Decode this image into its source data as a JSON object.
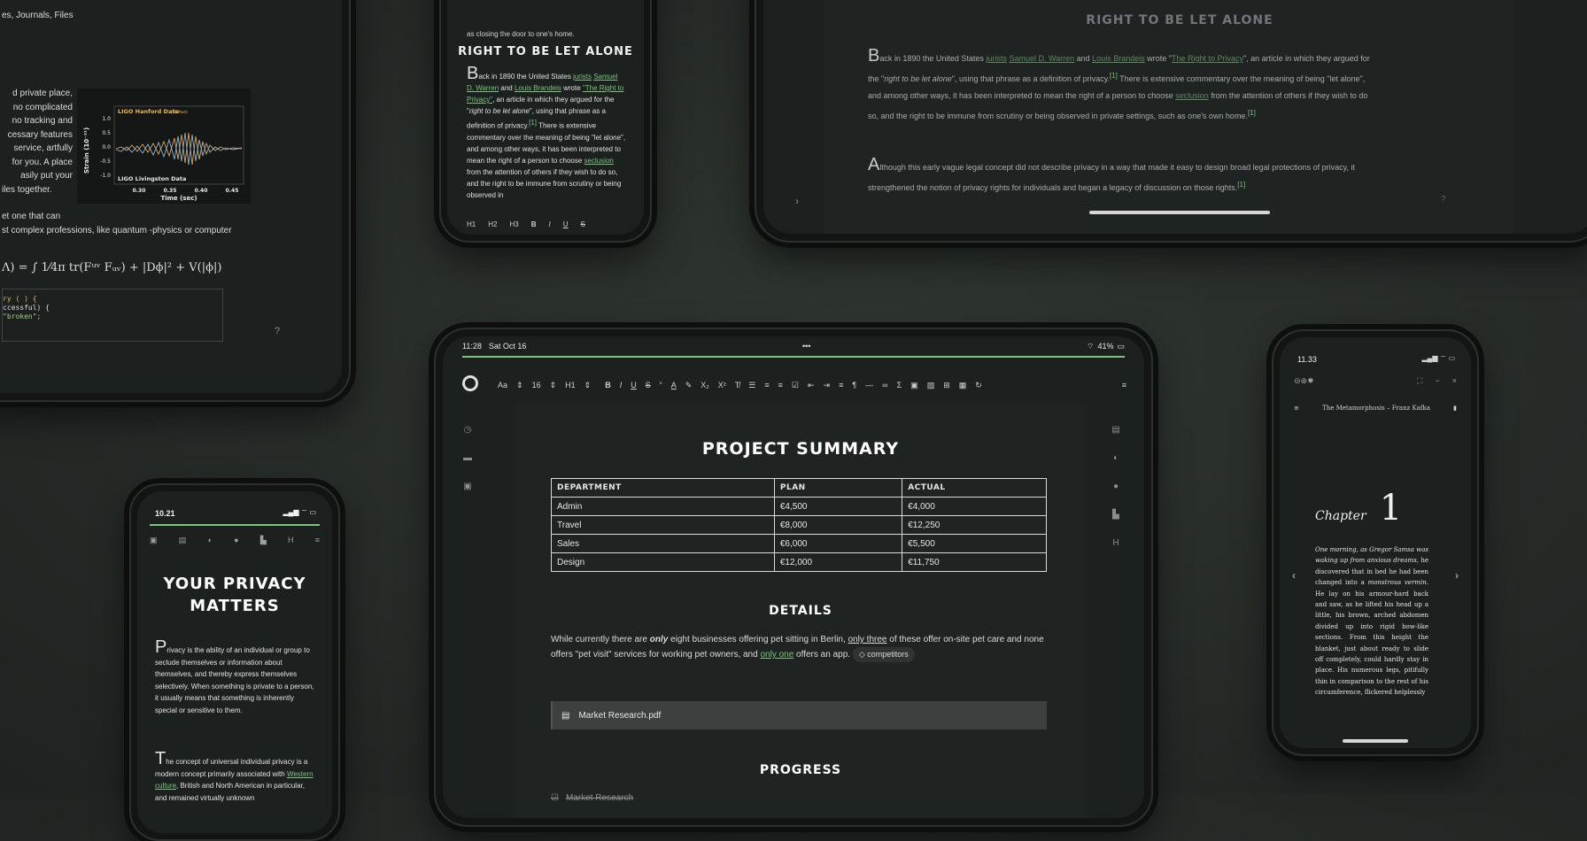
{
  "colors": {
    "accent": "#7cc47f",
    "background": "#262b28",
    "screen": "#1c201f"
  },
  "top_left_tablet": {
    "partial_heading": "es, Journals, Files",
    "para_lines": [
      "d private place,",
      "no complicated",
      "no tracking and",
      "cessary features",
      "service, artfully",
      "for you. A place",
      "asily put your",
      "iles together."
    ],
    "para_bold": "private",
    "line2": "et one that can",
    "line3": "st complex professions, like quantum -physics or computer",
    "formula": "Λ) = ∫ 1⁄4π tr(Fᵘᵛ Fᵤᵥ) + |Dϕ|² + V(|ϕ|)",
    "code": [
      "ry ( ) {",
      "ccessful) {",
      "\"broken\";"
    ],
    "chart": {
      "title_top": "LIGO Hanford Data",
      "title_top_note": "(shifted)",
      "title_bottom": "LIGO Livingston Data",
      "ylabel": "Strain (10⁻²¹)",
      "xlabel": "Time (sec)",
      "yticks": [
        "1.0",
        "0.5",
        "0.0",
        "-0.5",
        "-1.0"
      ],
      "xticks": [
        "0.30",
        "0.35",
        "0.40",
        "0.45"
      ]
    },
    "help": "?"
  },
  "top_phone": {
    "partial_line": "as closing the door to one's home.",
    "title": "RIGHT TO BE LET ALONE",
    "p_cap": "B",
    "p1a": "ack in 1890 the United States ",
    "link_jurists": "jurists",
    "link_warren": "Samuel D. Warren",
    "and": " and ",
    "link_brandeis": "Louis Brandeis",
    "wrote": " wrote",
    "link_right": "\"The Right to Privacy\"",
    "p1b": ", an article in which they argued for the \"",
    "italic": "right to be let alone",
    "p1c": "\", using that phrase as a definition of privacy.",
    "ref1": "[1]",
    "p1d": " There is extensive commentary over the meaning of being \"let alone\", and among other ways, it has been interpreted to mean the right of a person to choose ",
    "link_seclusion": "seclusion",
    "p1e": " from the attention of others if they wish to do so, and the right to be immune from scrutiny or being observed in",
    "toolbar": [
      "H1",
      "H2",
      "H3",
      "B",
      "I",
      "U",
      "S"
    ]
  },
  "top_right_tablet": {
    "title": "RIGHT TO BE LET ALONE",
    "p1_cap": "B",
    "p1a": "ack in 1890 the United States ",
    "link_jurists": "jurists",
    "link_warren": "Samuel D. Warren",
    "and": " and ",
    "link_brandeis": "Louis Brandeis",
    "wrote": " wrote \"",
    "link_right": "The Right to Privacy",
    "p1b": "\", an article in which they argued for the \"",
    "italic": "right to be let alone",
    "p1c": "\", using that phrase as a definition of privacy.",
    "ref1": "[1]",
    "p1d": " There is extensive commentary over the meaning of being \"let alone\", and among other ways, it has been interpreted to mean the right of a person to choose ",
    "link_seclusion": "seclusion",
    "p1e": " from the attention of others if they wish to do so, and the right to be immune from scrutiny or being observed in private settings, such as one's own home.",
    "ref2": "[1]",
    "p2_cap": "A",
    "p2": "lthough this early vague legal concept did not describe privacy in a way that made it easy to design broad legal protections of privacy, it strengthened the notion of privacy rights for individuals and began a legacy of discussion on those rights.",
    "ref3": "[1]",
    "nav_next": "›",
    "help": "?"
  },
  "bottom_left_phone": {
    "time": "10.21",
    "title_l1": "YOUR PRIVACY",
    "title_l2": "MATTERS",
    "p1_cap": "P",
    "p1": "rivacy is the ability of an individual or group to seclude themselves or information about themselves, and thereby express themselves selectively. When something is private to a person, it usually means that something is inherently special or sensitive to them.",
    "p2_cap": "T",
    "p2a": "he concept of universal individual privacy is a modern concept primarily associated with ",
    "link_western": "Western culture",
    "p2b": ", British and North American in particular, and remained virtually unknown"
  },
  "main_tablet": {
    "status": {
      "time": "11:28",
      "date": "Sat Oct 16",
      "dots": "•••",
      "battery": "41%"
    },
    "toolbar": {
      "font": "Aa",
      "size": "16",
      "heading": "H1",
      "items": [
        "B",
        "I",
        "U",
        "S",
        "“",
        "A",
        "✎",
        "X₂",
        "X²",
        "T̸",
        "☰",
        "≡",
        "≡",
        "☑",
        "⇤",
        "⇥",
        "≡",
        "¶",
        "—",
        "∞",
        "Σ",
        "▣",
        "▨",
        "⊞",
        "▦",
        "↻"
      ],
      "menu": "≡"
    },
    "doc_title": "PROJECT SUMMARY",
    "table": {
      "headers": [
        "DEPARTMENT",
        "PLAN",
        "ACTUAL"
      ],
      "rows": [
        [
          "Admin",
          "€4,500",
          "€4,000"
        ],
        [
          "Travel",
          "€8,000",
          "€12,250"
        ],
        [
          "Sales",
          "€6,000",
          "€5,500"
        ],
        [
          "Design",
          "€12,000",
          "€11,750"
        ]
      ]
    },
    "details_title": "DETAILS",
    "details": {
      "a": "While currently there are ",
      "bold": "only",
      "b": " eight businesses offering pet sitting in Berlin, ",
      "u1": "only three",
      "c": " of these offer on-site pet care and none offers \"pet visit\"  services for working pet owners, and ",
      "link": "only one",
      "d": " offers an app.",
      "chip": "competitors"
    },
    "file": "Market Research.pdf",
    "progress_title": "PROGRESS",
    "task": "Market Research"
  },
  "right_phone": {
    "time": "11.33",
    "book_title": "The Metamorphosis",
    "sep": " – ",
    "author": "Franz Kafka",
    "chapter_word": "Chapter",
    "chapter_num": "1",
    "text_italic_a": "One morning, as Gregor Samsa was waking up from anxious dreams,",
    "text_b": " he discovered that in bed he had been changed into a ",
    "text_italic_b": "monstrous vermin.",
    "text_c": " He lay on his armour-hard back and saw, as he lifted his head up a little, his brown, arched abdomen divided up into rigid bow-like sections. From this height the blanket, just about ready to slide off completely, could hardly stay in place. His numerous legs, pitifully thin in comparison to the rest of his circumference, flickered helplessly",
    "prev": "‹",
    "next": "›"
  }
}
